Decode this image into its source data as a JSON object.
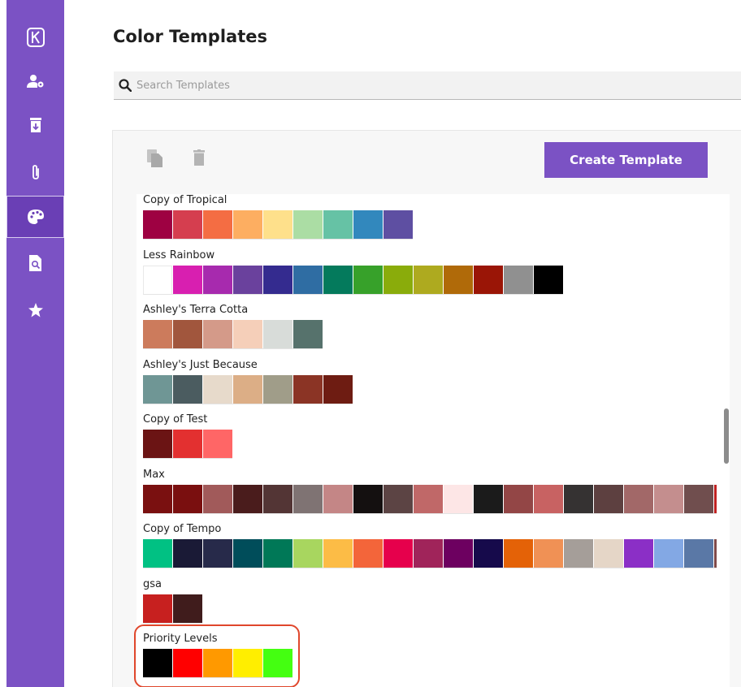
{
  "sidebar": {
    "items": [
      {
        "icon": "logo-icon",
        "active": false
      },
      {
        "icon": "user-settings-icon",
        "active": false
      },
      {
        "icon": "archive-icon",
        "active": false
      },
      {
        "icon": "paperclip-icon",
        "active": false
      },
      {
        "icon": "palette-icon",
        "active": true
      },
      {
        "icon": "file-search-icon",
        "active": false
      },
      {
        "icon": "star-icon",
        "active": false
      }
    ]
  },
  "header": {
    "title": "Color Templates"
  },
  "search": {
    "placeholder": "Search Templates",
    "value": ""
  },
  "toolbar": {
    "copy_icon": "copy-icon",
    "delete_icon": "trash-icon",
    "create_label": "Create Template"
  },
  "templates": [
    {
      "name": "Copy of Tropical",
      "colors": [
        "#9e0142",
        "#d53e4f",
        "#f46d43",
        "#fdae61",
        "#fee08b",
        "#abdda4",
        "#66c2a5",
        "#3288bd",
        "#5e4fa2"
      ]
    },
    {
      "name": "Less Rainbow",
      "colors": [
        "#ffffff",
        "#d81fb0",
        "#a72aae",
        "#6a419d",
        "#342b8f",
        "#2f6da3",
        "#047a5c",
        "#37a12a",
        "#8aac0b",
        "#aeaa1f",
        "#b06a09",
        "#9a1506",
        "#909090",
        "#000000"
      ]
    },
    {
      "name": "Ashley's Terra Cotta",
      "colors": [
        "#cc7b5c",
        "#a1563d",
        "#d49a89",
        "#f5cfb9",
        "#d8dcd9",
        "#56726c"
      ]
    },
    {
      "name": "Ashley's Just Because",
      "colors": [
        "#6f9695",
        "#4b5c60",
        "#e7dacb",
        "#dcae86",
        "#a09d89",
        "#8b3425",
        "#6e1c12"
      ]
    },
    {
      "name": "Copy of Test",
      "colors": [
        "#6b1414",
        "#e33030",
        "#ff6666"
      ]
    },
    {
      "name": "Max",
      "colors": [
        "#7a1010",
        "#7a0f0f",
        "#a15a5a",
        "#4a1c1c",
        "#533535",
        "#7f7373",
        "#c48686",
        "#141010",
        "#5c4444",
        "#c06868",
        "#fde6e6",
        "#1b1b1b",
        "#934646",
        "#c86262",
        "#353232",
        "#5d4040",
        "#a26868",
        "#c48e8e",
        "#704e4e",
        "#c02222"
      ]
    },
    {
      "name": "Copy of Tempo",
      "colors": [
        "#01c183",
        "#1a1a36",
        "#272a4a",
        "#004d5a",
        "#007857",
        "#a8d65f",
        "#fcbc46",
        "#f3653a",
        "#e6004c",
        "#a0245a",
        "#6d0060",
        "#160a4b",
        "#e46207",
        "#f09155",
        "#a59e99",
        "#e5d6c7",
        "#8b2fc6",
        "#83a8e4",
        "#5a78a6",
        "#7f4a4a"
      ]
    },
    {
      "name": "gsa",
      "colors": [
        "#c7201f",
        "#401c1c"
      ]
    },
    {
      "name": "Priority Levels",
      "colors": [
        "#000000",
        "#ff0000",
        "#ff9900",
        "#ffee00",
        "#44ff11"
      ]
    }
  ]
}
